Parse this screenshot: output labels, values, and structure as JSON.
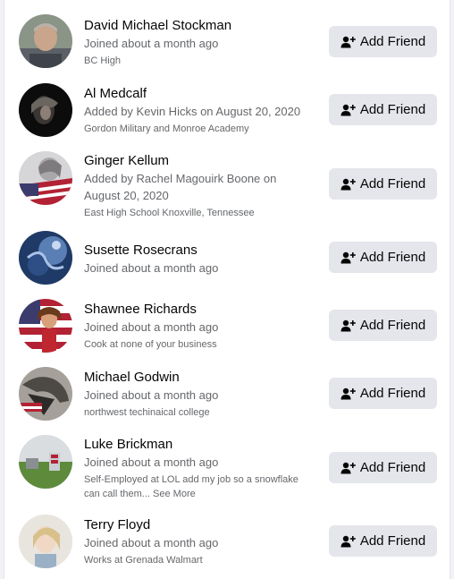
{
  "colors": {
    "button_bg": "#e4e6eb",
    "text": "#050505",
    "secondary": "#65676b"
  },
  "button_icon": "add-friend-icon",
  "people": [
    {
      "name": "David Michael Stockman",
      "subtitle": "Joined about a month ago",
      "detail": "BC High",
      "button": "Add Friend"
    },
    {
      "name": "Al Medcalf",
      "subtitle": "Added by Kevin Hicks on August 20, 2020",
      "detail": "Gordon Military and Monroe Academy",
      "button": "Add Friend"
    },
    {
      "name": "Ginger Kellum",
      "subtitle_line1": "Added by Rachel Magouirk Boone on",
      "subtitle_line2": "August 20, 2020",
      "detail": "East High School Knoxville, Tennessee",
      "button": "Add Friend"
    },
    {
      "name": "Susette Rosecrans",
      "subtitle": "Joined about a month ago",
      "button": "Add Friend"
    },
    {
      "name": "Shawnee Richards",
      "subtitle": "Joined about a month ago",
      "detail": "Cook at none of your business",
      "button": "Add Friend"
    },
    {
      "name": "Michael Godwin",
      "subtitle": "Joined about a month ago",
      "detail": "northwest techinaical college",
      "button": "Add Friend"
    },
    {
      "name": "Luke Brickman",
      "subtitle": "Joined about a month ago",
      "detail_line1": "Self-Employed at LOL add my job so a snowflake",
      "detail_line2": "can call them...",
      "see_more": "See More",
      "button": "Add Friend"
    },
    {
      "name": "Terry Floyd",
      "subtitle": "Joined about a month ago",
      "detail": "Works at Grenada Walmart",
      "button": "Add Friend"
    }
  ]
}
